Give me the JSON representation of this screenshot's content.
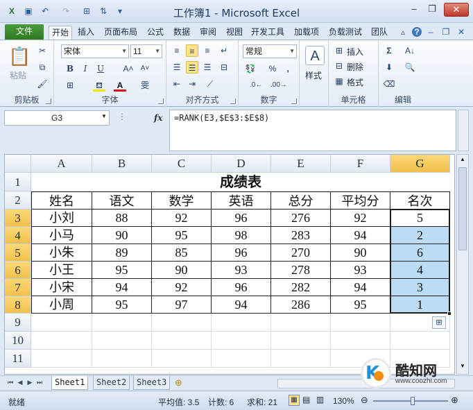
{
  "window": {
    "title": "工作簿1 - Microsoft Excel",
    "minimize": "–",
    "restore": "❐",
    "close": "✕"
  },
  "ribbon_tabs": [
    "文件",
    "开始",
    "插入",
    "页面布局",
    "公式",
    "数据",
    "审阅",
    "视图",
    "开发工具",
    "加载项",
    "负载测试",
    "团队"
  ],
  "ribbon": {
    "clipboard": {
      "paste": "粘贴",
      "label": "剪贴板"
    },
    "font": {
      "name": "宋体",
      "size": "11",
      "label": "字体",
      "bold": "B",
      "italic": "I",
      "underline": "U"
    },
    "alignment": {
      "label": "对齐方式"
    },
    "number": {
      "format": "常规",
      "percent": "%",
      "comma": ",",
      "label": "数字"
    },
    "styles": {
      "label": "样式"
    },
    "cells": {
      "insert": "插入",
      "delete": "删除",
      "format": "格式",
      "label": "单元格"
    },
    "editing": {
      "sum": "Σ",
      "label": "编辑"
    }
  },
  "formula_bar": {
    "name_box": "G3",
    "fx": "fx",
    "formula": "=RANK(E3,$E$3:$E$8)"
  },
  "columns": [
    "A",
    "B",
    "C",
    "D",
    "E",
    "F",
    "G"
  ],
  "rows": [
    "1",
    "2",
    "3",
    "4",
    "5",
    "6",
    "7",
    "8",
    "9",
    "10",
    "11"
  ],
  "selected_column": "G",
  "selected_rows": [
    "3",
    "4",
    "5",
    "6",
    "7",
    "8"
  ],
  "sheet_title": "成绩表",
  "table": {
    "headers": [
      "姓名",
      "语文",
      "数学",
      "英语",
      "总分",
      "平均分",
      "名次"
    ],
    "rows": [
      [
        "小刘",
        "88",
        "92",
        "96",
        "276",
        "92",
        "5"
      ],
      [
        "小马",
        "90",
        "95",
        "98",
        "283",
        "94",
        "2"
      ],
      [
        "小朱",
        "89",
        "85",
        "96",
        "270",
        "90",
        "6"
      ],
      [
        "小王",
        "95",
        "90",
        "93",
        "278",
        "93",
        "4"
      ],
      [
        "小宋",
        "94",
        "92",
        "96",
        "282",
        "94",
        "3"
      ],
      [
        "小周",
        "95",
        "97",
        "94",
        "286",
        "95",
        "1"
      ]
    ]
  },
  "sheet_tabs": [
    "Sheet1",
    "Sheet2",
    "Sheet3"
  ],
  "active_sheet": "Sheet1",
  "status": {
    "mode": "就绪",
    "average": "平均值: 3.5",
    "count": "计数: 6",
    "sum": "求和: 21",
    "zoom": "130%"
  },
  "watermark": {
    "brand": "酷知网",
    "url": "www.coozhi.com"
  },
  "colors": {
    "selection": "#bcdbf5",
    "header_highlight": "#f3c04b",
    "file_tab": "#2f7a22"
  }
}
